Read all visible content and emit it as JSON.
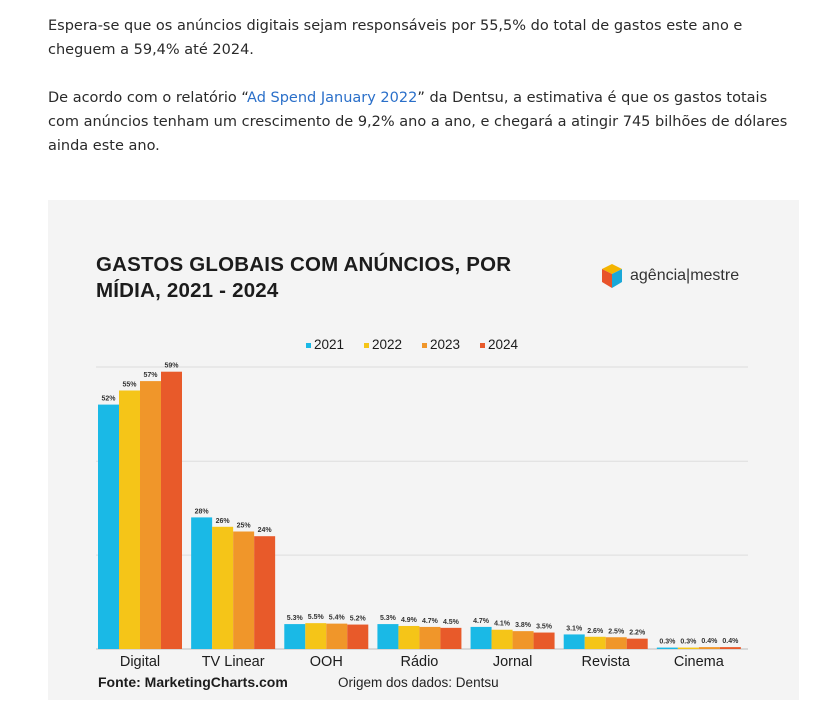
{
  "article": {
    "p1": "Espera-se que os anúncios digitais sejam responsáveis por 55,5% do total de gastos este ano e cheguem a 59,4% até 2024.",
    "p2_before": "De acordo com o relatório “",
    "p2_link": "Ad Spend January 2022",
    "p2_after": "” da Dentsu, a estimativa é que os gastos totais com anúncios tenham um crescimento de 9,2% ano a ano, e chegará a atingir 745 bilhões de dólares ainda este ano."
  },
  "brand": {
    "logo_text": "agência|mestre"
  },
  "footer": {
    "source": "Fonte: MarketingCharts.com",
    "origin": "Origem dos dados: Dentsu"
  },
  "chart_data": {
    "type": "bar",
    "title": "GASTOS GLOBAIS COM ANÚNCIOS, POR MÍDIA, 2021 - 2024",
    "categories": [
      "Digital",
      "TV Linear",
      "OOH",
      "Rádio",
      "Jornal",
      "Revista",
      "Cinema"
    ],
    "series": [
      {
        "name": "2021",
        "color": "#1ab9e6",
        "values": [
          52,
          28,
          5.3,
          5.3,
          4.7,
          3.1,
          0.3
        ],
        "labels": [
          "52%",
          "28%",
          "5.3%",
          "5.3%",
          "4.7%",
          "3.1%",
          "0.3%"
        ]
      },
      {
        "name": "2022",
        "color": "#f5c518",
        "values": [
          55,
          26,
          5.5,
          4.9,
          4.1,
          2.6,
          0.3
        ],
        "labels": [
          "55%",
          "26%",
          "5.5%",
          "4.9%",
          "4.1%",
          "2.6%",
          "0.3%"
        ]
      },
      {
        "name": "2023",
        "color": "#f0962a",
        "values": [
          57,
          25,
          5.4,
          4.7,
          3.8,
          2.5,
          0.4
        ],
        "labels": [
          "57%",
          "25%",
          "5.4%",
          "4.7%",
          "3.8%",
          "2.5%",
          "0.4%"
        ]
      },
      {
        "name": "2024",
        "color": "#e85a2a",
        "values": [
          59,
          24,
          5.2,
          4.5,
          3.5,
          2.2,
          0.4
        ],
        "labels": [
          "59%",
          "24%",
          "5.2%",
          "4.5%",
          "3.5%",
          "2.2%",
          "0.4%"
        ]
      }
    ],
    "ylim": [
      0,
      60
    ],
    "grid": true,
    "legend_position": "top"
  }
}
